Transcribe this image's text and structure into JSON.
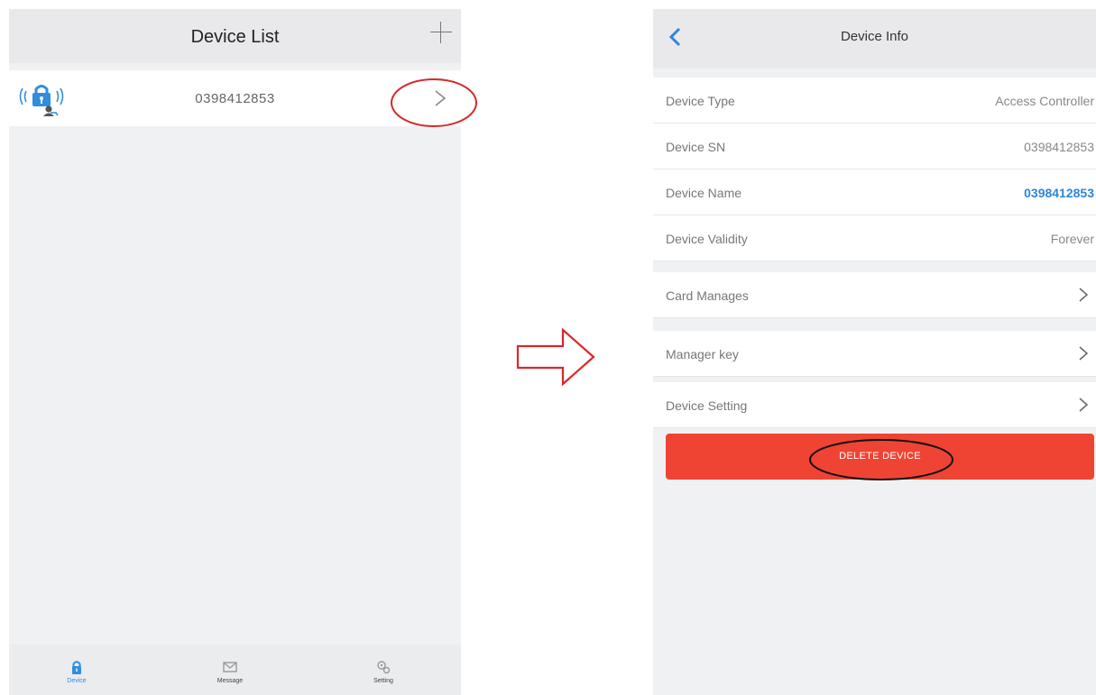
{
  "left_screen": {
    "title": "Device List",
    "device": {
      "serial": "0398412853"
    },
    "tabs": [
      {
        "label": "Device"
      },
      {
        "label": "Message"
      },
      {
        "label": "Setting"
      }
    ]
  },
  "right_screen": {
    "title": "Device Info",
    "rows": [
      {
        "label": "Device Type",
        "value": "Access Controller"
      },
      {
        "label": "Device SN",
        "value": "0398412853"
      },
      {
        "label": "Device Name",
        "value": "0398412853"
      },
      {
        "label": "Device Validity",
        "value": "Forever"
      }
    ],
    "nav_rows": [
      {
        "label": "Card Manages"
      },
      {
        "label": "Manager key"
      },
      {
        "label": "Device Setting"
      }
    ],
    "delete_label": "DELETE DEVICE"
  },
  "colors": {
    "accent_blue": "#2f86d8",
    "delete_red": "#ef4434",
    "annotation_red": "#d8282a",
    "annotation_black": "#111111"
  }
}
